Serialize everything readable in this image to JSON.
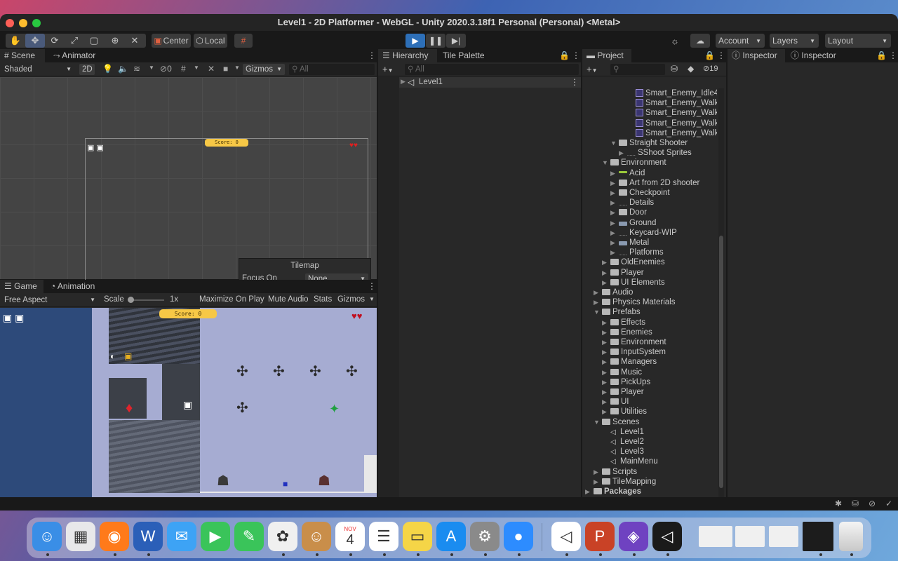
{
  "window": {
    "title": "Level1 - 2D Platformer - WebGL - Unity 2020.3.18f1 Personal (Personal) <Metal>"
  },
  "toolbar": {
    "center": "Center",
    "local": "Local",
    "account": "Account",
    "layers": "Layers",
    "layout": "Layout"
  },
  "scene_panel": {
    "tab_scene": "Scene",
    "tab_animator": "Animator",
    "shading": "Shaded",
    "mode_2d": "2D",
    "hidden_count": "0",
    "gizmos": "Gizmos",
    "search_placeholder": "All",
    "score_text": "Score: 0",
    "tilemap_title": "Tilemap",
    "focus_label": "Focus On",
    "focus_value": "None"
  },
  "game_panel": {
    "tab_game": "Game",
    "tab_animation": "Animation",
    "aspect": "Free Aspect",
    "scale_label": "Scale",
    "scale_value": "1x",
    "maximize": "Maximize On Play",
    "mute": "Mute Audio",
    "stats": "Stats",
    "gizmos": "Gizmos",
    "score_text": "Score: 0"
  },
  "hierarchy": {
    "tab_hierarchy": "Hierarchy",
    "tab_tile_palette": "Tile Palette",
    "search_placeholder": "All",
    "scene_item": "Level1"
  },
  "project": {
    "tab": "Project",
    "hidden_count": "19",
    "items": [
      {
        "label": "Smart_Enemy_Idle4",
        "icon": "asset",
        "indent": 6,
        "arrow": ""
      },
      {
        "label": "Smart_Enemy_Walki",
        "icon": "asset",
        "indent": 6,
        "arrow": ""
      },
      {
        "label": "Smart_Enemy_Walki",
        "icon": "asset",
        "indent": 6,
        "arrow": ""
      },
      {
        "label": "Smart_Enemy_Walki",
        "icon": "asset",
        "indent": 6,
        "arrow": ""
      },
      {
        "label": "Smart_Enemy_Walki",
        "icon": "asset",
        "indent": 6,
        "arrow": ""
      },
      {
        "label": "Straight Shooter",
        "icon": "folder",
        "indent": 4,
        "arrow": "down"
      },
      {
        "label": "SShoot Sprites",
        "icon": "sprite",
        "indent": 5,
        "arrow": "right"
      },
      {
        "label": "Environment",
        "icon": "folder",
        "indent": 3,
        "arrow": "down"
      },
      {
        "label": "Acid",
        "icon": "acid",
        "indent": 4,
        "arrow": "right"
      },
      {
        "label": "Art from 2D shooter",
        "icon": "folder",
        "indent": 4,
        "arrow": "right"
      },
      {
        "label": "Checkpoint",
        "icon": "folder",
        "indent": 4,
        "arrow": "right"
      },
      {
        "label": "Details",
        "icon": "sprite",
        "indent": 4,
        "arrow": "right"
      },
      {
        "label": "Door",
        "icon": "folder",
        "indent": 4,
        "arrow": "right"
      },
      {
        "label": "Ground",
        "icon": "ground",
        "indent": 4,
        "arrow": "right"
      },
      {
        "label": "Keycard-WIP",
        "icon": "sprite",
        "indent": 4,
        "arrow": "right"
      },
      {
        "label": "Metal",
        "icon": "ground",
        "indent": 4,
        "arrow": "right"
      },
      {
        "label": "Platforms",
        "icon": "sprite",
        "indent": 4,
        "arrow": "right"
      },
      {
        "label": "OldEnemies",
        "icon": "folder",
        "indent": 3,
        "arrow": "right"
      },
      {
        "label": "Player",
        "icon": "folder",
        "indent": 3,
        "arrow": "right"
      },
      {
        "label": "UI Elements",
        "icon": "folder",
        "indent": 3,
        "arrow": "right"
      },
      {
        "label": "Audio",
        "icon": "folder",
        "indent": 2,
        "arrow": "right"
      },
      {
        "label": "Physics Materials",
        "icon": "folder",
        "indent": 2,
        "arrow": "right"
      },
      {
        "label": "Prefabs",
        "icon": "folder",
        "indent": 2,
        "arrow": "down"
      },
      {
        "label": "Effects",
        "icon": "folder",
        "indent": 3,
        "arrow": "right"
      },
      {
        "label": "Enemies",
        "icon": "folder",
        "indent": 3,
        "arrow": "right"
      },
      {
        "label": "Environment",
        "icon": "folder",
        "indent": 3,
        "arrow": "right"
      },
      {
        "label": "InputSystem",
        "icon": "folder",
        "indent": 3,
        "arrow": "right"
      },
      {
        "label": "Managers",
        "icon": "folder",
        "indent": 3,
        "arrow": "right"
      },
      {
        "label": "Music",
        "icon": "folder",
        "indent": 3,
        "arrow": "right"
      },
      {
        "label": "PickUps",
        "icon": "folder",
        "indent": 3,
        "arrow": "right"
      },
      {
        "label": "Player",
        "icon": "folder",
        "indent": 3,
        "arrow": "right"
      },
      {
        "label": "UI",
        "icon": "folder",
        "indent": 3,
        "arrow": "right"
      },
      {
        "label": "Utilities",
        "icon": "folder",
        "indent": 3,
        "arrow": "right"
      },
      {
        "label": "Scenes",
        "icon": "folder",
        "indent": 2,
        "arrow": "down"
      },
      {
        "label": "Level1",
        "icon": "scene",
        "indent": 3,
        "arrow": ""
      },
      {
        "label": "Level2",
        "icon": "scene",
        "indent": 3,
        "arrow": ""
      },
      {
        "label": "Level3",
        "icon": "scene",
        "indent": 3,
        "arrow": ""
      },
      {
        "label": "MainMenu",
        "icon": "scene",
        "indent": 3,
        "arrow": ""
      },
      {
        "label": "Scripts",
        "icon": "folder",
        "indent": 2,
        "arrow": "right"
      },
      {
        "label": "TileMapping",
        "icon": "folder",
        "indent": 2,
        "arrow": "right"
      },
      {
        "label": "Packages",
        "icon": "folder",
        "indent": 1,
        "arrow": "right"
      }
    ]
  },
  "inspector": {
    "tab1": "Inspector",
    "tab2": "Inspector"
  },
  "dock": {
    "calendar_month": "NOV",
    "calendar_day": "4",
    "apps": [
      "finder-icon",
      "launchpad-icon",
      "firefox-icon",
      "word-icon",
      "mail-icon",
      "facetime-icon",
      "messages-icon",
      "photos-icon",
      "contacts-icon",
      "calendar-icon",
      "reminders-icon",
      "notes-icon",
      "app-store-icon",
      "system-preferences-icon",
      "zoom-icon",
      "unity-hub-icon",
      "powerpoint-icon",
      "visual-studio-icon",
      "unity-icon"
    ]
  }
}
